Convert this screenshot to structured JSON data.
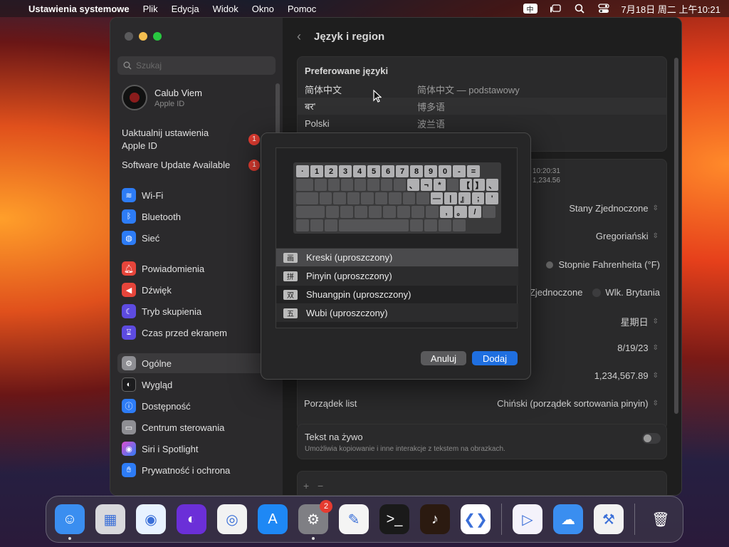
{
  "menubar": {
    "app": "Ustawienia systemowe",
    "items": [
      "Plik",
      "Edycja",
      "Widok",
      "Okno",
      "Pomoc"
    ],
    "ime_badge": "中",
    "clock": "7月18日 周二 上午10:21"
  },
  "window": {
    "title": "Język i region",
    "search_placeholder": "Szukaj",
    "account": {
      "name": "Calub Viem",
      "sub": "Apple ID"
    },
    "updates": [
      {
        "label": "Uaktualnij ustawienia Apple ID",
        "badge": "1"
      },
      {
        "label": "Software Update Available",
        "badge": "1"
      }
    ],
    "sidebar": [
      {
        "label": "Wi-Fi",
        "icon": "wifi-icon",
        "color": "#2d7cf6"
      },
      {
        "label": "Bluetooth",
        "icon": "bluetooth-icon",
        "color": "#2d7cf6"
      },
      {
        "label": "Sieć",
        "icon": "globe-icon",
        "color": "#2d7cf6"
      },
      {
        "label": "Powiadomienia",
        "icon": "bell-icon",
        "color": "#e6453b"
      },
      {
        "label": "Dźwięk",
        "icon": "speaker-icon",
        "color": "#e6453b"
      },
      {
        "label": "Tryb skupienia",
        "icon": "moon-icon",
        "color": "#5d4be0"
      },
      {
        "label": "Czas przed ekranem",
        "icon": "hourglass-icon",
        "color": "#5d4be0"
      },
      {
        "label": "Ogólne",
        "icon": "gear-icon",
        "color": "#8e8e93"
      },
      {
        "label": "Wygląd",
        "icon": "appearance-icon",
        "color": "#1c1c1e"
      },
      {
        "label": "Dostępność",
        "icon": "accessibility-icon",
        "color": "#2d7cf6"
      },
      {
        "label": "Centrum sterowania",
        "icon": "control-center-icon",
        "color": "#8e8e93"
      },
      {
        "label": "Siri i Spotlight",
        "icon": "siri-icon",
        "color": "#b04fd9"
      },
      {
        "label": "Prywatność i ochrona",
        "icon": "hand-icon",
        "color": "#2d7cf6"
      }
    ],
    "preferred": {
      "heading": "Preferowane języki",
      "rows": [
        {
          "a": "简体中文",
          "b": "简体中文 — podstawowy"
        },
        {
          "a": "बर'",
          "b": "博多语"
        },
        {
          "a": "Polski",
          "b": "波兰语"
        }
      ]
    },
    "sample_time": "10:20:31",
    "sample_num": "1,234.56",
    "region": "Stany Zjednoczone",
    "calendar": "Gregoriański",
    "temperature": "Stopnie Fahrenheita (°F)",
    "measure_a": "Stany Zjednoczone",
    "measure_b": "Wlk. Brytania",
    "first_day": "星期日",
    "date_format": "8/19/23",
    "number_format": "1,234,567.89",
    "sort_label": "Porządek list",
    "sort_value": "Chiński (porządek sortowania pinyin)",
    "livetext_title": "Tekst na żywo",
    "livetext_desc": "Umożliwia kopiowanie i inne interakcje z tekstem na obrazkach.",
    "plus": "+",
    "minus": "−"
  },
  "dialog": {
    "keyboard_rows": [
      [
        "·",
        "1",
        "2",
        "3",
        "4",
        "5",
        "6",
        "7",
        "8",
        "9",
        "0",
        "-",
        "="
      ],
      [
        "",
        "",
        "",
        "",
        "",
        "",
        "",
        "、",
        "¬",
        "*",
        "",
        "【",
        "】",
        "、"
      ],
      [
        "",
        "",
        "",
        "",
        "",
        "",
        "",
        "",
        "—",
        "|",
        "』",
        ";",
        "'"
      ],
      [
        "",
        "",
        "",
        "",
        "",
        "",
        "",
        "",
        ",",
        "。",
        "/",
        ""
      ]
    ],
    "methods": [
      {
        "glyph": "画",
        "label": "Kreski (uproszczony)"
      },
      {
        "glyph": "拼",
        "label": "Pinyin (uproszczony)"
      },
      {
        "glyph": "双",
        "label": "Shuangpin (uproszczony)"
      },
      {
        "glyph": "五",
        "label": "Wubi (uproszczony)"
      }
    ],
    "cancel": "Anuluj",
    "add": "Dodaj"
  },
  "dock": {
    "apps": [
      {
        "name": "finder",
        "color": "#3a8ef0",
        "glyph": "☺",
        "running": true
      },
      {
        "name": "launchpad",
        "color": "#d8d8dc",
        "glyph": "▦",
        "running": false
      },
      {
        "name": "safari",
        "color": "#e8f2ff",
        "glyph": "◉",
        "running": false
      },
      {
        "name": "firefox",
        "color": "#6b2fd8",
        "glyph": "◐",
        "running": false
      },
      {
        "name": "chrome",
        "color": "#f2f2f2",
        "glyph": "◎",
        "running": false
      },
      {
        "name": "app-store",
        "color": "#1e88f5",
        "glyph": "A",
        "running": false
      },
      {
        "name": "system-settings",
        "color": "#7f7f84",
        "glyph": "⚙",
        "running": true,
        "badge": "2"
      },
      {
        "name": "textedit",
        "color": "#f4f4f4",
        "glyph": "✎",
        "running": false
      },
      {
        "name": "terminal",
        "color": "#1a1a1a",
        "glyph": ">_",
        "running": false
      },
      {
        "name": "garageband",
        "color": "#2b1a10",
        "glyph": "♪",
        "running": false
      },
      {
        "name": "vscode",
        "color": "#ffffff",
        "glyph": "❮❯",
        "running": false
      },
      {
        "sep": true
      },
      {
        "name": "visual-studio",
        "color": "#f4f2fb",
        "glyph": "▷",
        "running": false
      },
      {
        "name": "weather",
        "color": "#3a8ef0",
        "glyph": "☁",
        "running": false
      },
      {
        "name": "instruments",
        "color": "#f2f2f2",
        "glyph": "⚒",
        "running": false
      },
      {
        "sep": true
      },
      {
        "name": "trash",
        "color": "transparent",
        "glyph": "🗑",
        "running": false
      }
    ]
  }
}
